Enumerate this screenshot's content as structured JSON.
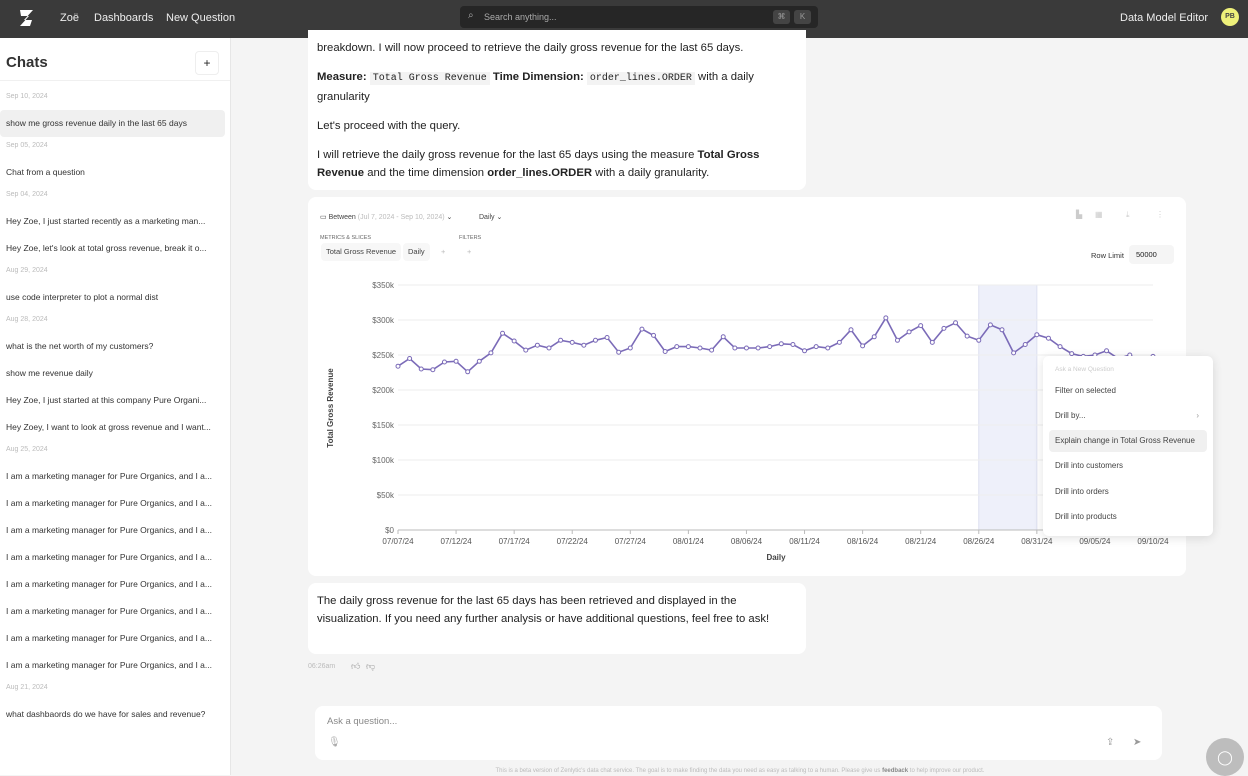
{
  "header": {
    "nav": [
      "Zoë",
      "Dashboards",
      "New Question"
    ],
    "search_placeholder": "Search anything...",
    "kbd": [
      "⌘",
      "K"
    ],
    "data_model_editor": "Data Model Editor",
    "avatar": "PB"
  },
  "sidebar": {
    "title": "Chats",
    "add": "+",
    "groups": [
      {
        "date": "Sep 10, 2024",
        "items": [
          "show me gross revenue daily in the last 65 days"
        ]
      },
      {
        "date": "Sep 05, 2024",
        "items": [
          "Chat from a question"
        ]
      },
      {
        "date": "Sep 04, 2024",
        "items": [
          "Hey Zoe, I just started recently as a marketing man...",
          "Hey Zoe, let's look at total gross revenue, break it o..."
        ]
      },
      {
        "date": "Aug 29, 2024",
        "items": [
          "use code interpreter to plot a normal dist"
        ]
      },
      {
        "date": "Aug 28, 2024",
        "items": [
          "what is the net worth of my customers?",
          "show me revenue daily",
          "Hey Zoe, I just started at this company Pure Organi...",
          "Hey Zoey, I want to look at gross revenue and I want..."
        ]
      },
      {
        "date": "Aug 25, 2024",
        "items": [
          "I am a marketing manager for Pure Organics, and I a...",
          "I am a marketing manager for Pure Organics, and I a...",
          "I am a marketing manager for Pure Organics, and I a...",
          "I am a marketing manager for Pure Organics, and I a...",
          "I am a marketing manager for Pure Organics, and I a...",
          "I am a marketing manager for Pure Organics, and I a...",
          "I am a marketing manager for Pure Organics, and I a...",
          "I am a marketing manager for Pure Organics, and I a..."
        ]
      },
      {
        "date": "Aug 21, 2024",
        "items": [
          "what dashbaords do we have for sales and revenue?"
        ]
      }
    ]
  },
  "message1": {
    "p1": "breakdown. I will now proceed to retrieve the daily gross revenue for the last 65 days.",
    "measure_label": "Measure:",
    "measure": "Total Gross Revenue",
    "time_label": "Time Dimension:",
    "time_dim": "order_lines.ORDER",
    "p2_tail": "with a daily granularity",
    "p3": "Let's proceed with the query.",
    "p4a": "I will retrieve the daily gross revenue for the last 65 days using the measure",
    "p4b": "Total Gross Revenue",
    "p4c": "and the time dimension",
    "p4d": "order_lines.ORDER",
    "p4e": "with a daily granularity."
  },
  "chart_panel": {
    "between": "Between",
    "range": "(Jul 7, 2024 - Sep 10, 2024)",
    "granularity": "Daily",
    "metrics_label": "METRICS & SLICES",
    "filters_label": "FILTERS",
    "metric": "Total Gross Revenue",
    "slice": "Daily",
    "row_limit_label": "Row Limit",
    "row_limit": "50000"
  },
  "chart_data": {
    "type": "line",
    "xlabel": "Daily",
    "ylabel": "Total Gross Revenue",
    "ylim": [
      0,
      350000
    ],
    "yticks": [
      "$0",
      "$50k",
      "$100k",
      "$150k",
      "$200k",
      "$250k",
      "$300k",
      "$350k"
    ],
    "xticks": [
      "07/07/24",
      "07/12/24",
      "07/17/24",
      "07/22/24",
      "07/27/24",
      "08/01/24",
      "08/06/24",
      "08/11/24",
      "08/16/24",
      "08/21/24",
      "08/26/24",
      "08/31/24",
      "09/05/24",
      "09/10/24"
    ],
    "x_start": "2024-07-07",
    "x_end": "2024-09-10",
    "selected_range": [
      "08/26/24",
      "08/31/24"
    ],
    "color": "#7b6bb8",
    "grid": true,
    "values": [
      234000,
      245000,
      230000,
      229000,
      240000,
      241000,
      226000,
      241000,
      253000,
      281000,
      270000,
      257000,
      264000,
      260000,
      271000,
      268000,
      264000,
      271000,
      275000,
      254000,
      260000,
      287000,
      278000,
      255000,
      262000,
      262000,
      260000,
      257000,
      276000,
      260000,
      260000,
      260000,
      262000,
      266000,
      265000,
      256000,
      262000,
      260000,
      268000,
      286000,
      263000,
      276000,
      303000,
      271000,
      283000,
      292000,
      268000,
      288000,
      296000,
      277000,
      271000,
      293000,
      286000,
      253000,
      265000,
      279000,
      274000,
      262000,
      252000,
      248000,
      250000,
      256000,
      245000,
      250000,
      240000,
      248000
    ]
  },
  "context_menu": {
    "title": "Ask a New Question",
    "items": [
      "Filter on selected",
      "Drill by...",
      "Explain change in Total Gross Revenue",
      "Drill into customers",
      "Drill into orders",
      "Drill into products"
    ]
  },
  "message2": {
    "text": "The daily gross revenue for the last 65 days has been retrieved and displayed in the visualization. If you need any further analysis or have additional questions, feel free to ask!",
    "time": "06:26am"
  },
  "input": {
    "placeholder": "Ask a question..."
  },
  "footer": {
    "text": "This is a beta version of Zenlytic's data chat service. The goal is to make finding the data you need as easy as talking to a human. Please give us",
    "link": "feedback",
    "tail": "to help improve our product."
  }
}
